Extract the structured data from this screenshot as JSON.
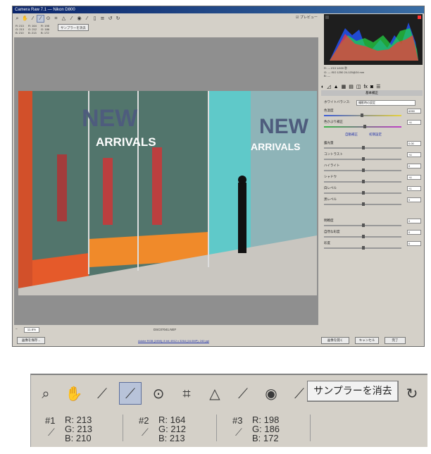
{
  "window": {
    "title": "Camera Raw 7.1 — Nikon D800",
    "preview_label": "プレビュー",
    "zoom_value": "11.6%",
    "filename": "DSC07041.NEF",
    "workflow_link": "Adobe RGB (1998); 8 bit; 4912 x 3264 (16.0MP); 240 ppi",
    "buttons": {
      "save": "画像を保存...",
      "open": "画像を開く",
      "cancel": "キャンセル",
      "done": "完了"
    },
    "samplers_small": [
      {
        "num": "#1",
        "r": "R: 213",
        "g": "G: 213",
        "b": "B: 210"
      },
      {
        "num": "#2",
        "r": "R: 164",
        "g": "G: 212",
        "b": "B: 213"
      },
      {
        "num": "#3",
        "r": "R: 198",
        "g": "G: 186",
        "b": "B: 172"
      }
    ],
    "clear_small": "サンプラーを消去",
    "readout": {
      "line1": "R: ---   f/13  1/400 秒",
      "line2": "G: ---   ISO 1250  24-120@24 mm",
      "line3": "B: ---"
    },
    "panel_title": "基本補正",
    "white_balance_label": "ホワイトバランス:",
    "white_balance_value": "撮影時の設定",
    "temperature_label": "色温度",
    "temperature_value": "6050",
    "tint_label": "色かぶり補正",
    "tint_value": "+4",
    "auto_link": "自動補正",
    "default_link": "初期設定",
    "sliders": [
      {
        "label": "露光量",
        "value": "0.00"
      },
      {
        "label": "コントラスト",
        "value": "+4"
      },
      {
        "label": "ハイライト",
        "value": "0"
      },
      {
        "label": "シャドウ",
        "value": "+4"
      },
      {
        "label": "白レベル",
        "value": "+1"
      },
      {
        "label": "黒レベル",
        "value": "0"
      }
    ],
    "sliders2": [
      {
        "label": "明瞭度",
        "value": "0"
      },
      {
        "label": "自然な彩度",
        "value": "0"
      },
      {
        "label": "彩度",
        "value": "0"
      }
    ],
    "photo_text": {
      "new_left": "NEW",
      "arrivals_left": "ARRIVALS",
      "new_right": "NEW",
      "arrivals_right": "ARRIVALS"
    }
  },
  "zoom": {
    "tools": [
      "zoom-icon",
      "hand-icon",
      "white-balance-icon",
      "color-sampler-icon",
      "target-adjust-icon",
      "crop-icon",
      "straighten-icon",
      "spot-removal-icon",
      "red-eye-icon",
      "adjustment-brush-icon",
      "graduated-filter-icon",
      "preferences-icon",
      "rotate-ccw-icon",
      "rotate-cw-icon"
    ],
    "samplers": [
      {
        "num": "#1",
        "r": "R: 213",
        "g": "G: 213",
        "b": "B: 210"
      },
      {
        "num": "#2",
        "r": "R: 164",
        "g": "G: 212",
        "b": "B: 213"
      },
      {
        "num": "#3",
        "r": "R: 198",
        "g": "G: 186",
        "b": "B: 172"
      }
    ],
    "clear_button": "サンプラーを消去"
  }
}
